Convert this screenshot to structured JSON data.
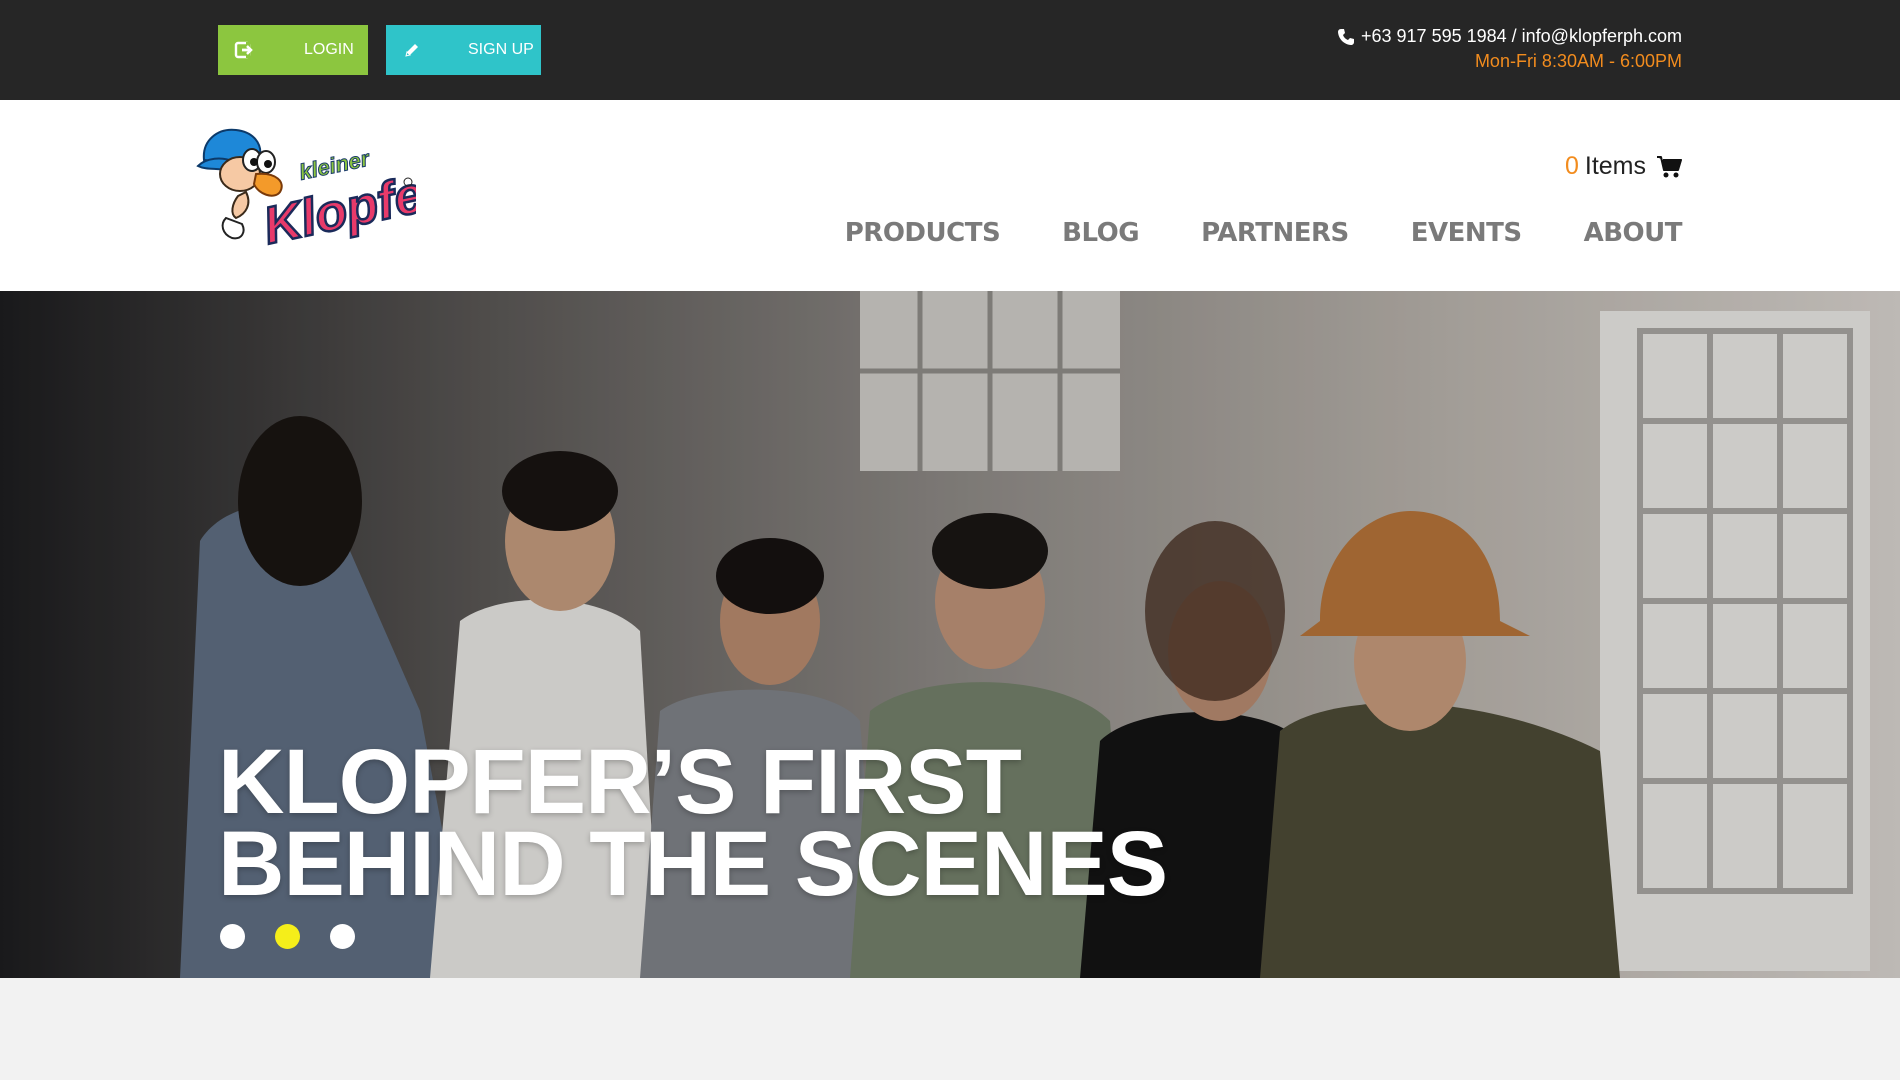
{
  "topbar": {
    "login_label": "LOGIN",
    "signup_label": "SIGN UP",
    "contact_line1": "+63 917 595 1984 / info@klopferph.com",
    "contact_line2": "Mon-Fri 8:30AM - 6:00PM"
  },
  "header": {
    "logo_text_small": "kleiner",
    "logo_text_big": "Klopfer",
    "cart_count": "0",
    "cart_label": "Items",
    "nav": [
      "PRODUCTS",
      "BLOG",
      "PARTNERS",
      "EVENTS",
      "ABOUT"
    ]
  },
  "hero": {
    "title_line1": "KLOPFER’S FIRST",
    "title_line2": "BEHIND THE SCENES",
    "slides": 3,
    "active_slide": 2
  },
  "colors": {
    "topbar_bg": "#262626",
    "login_green": "#8cc63f",
    "signup_teal": "#2fc4c9",
    "accent_orange": "#f28c1e",
    "active_dot": "#f5ee1a",
    "nav_grey": "#7a7a7a"
  },
  "icons": {
    "login": "sign-in-icon",
    "signup": "pencil-icon",
    "phone": "phone-icon",
    "cart": "shopping-cart-icon"
  }
}
